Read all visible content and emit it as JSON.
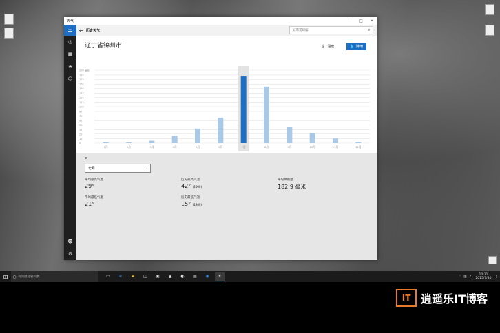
{
  "window": {
    "title": "天气",
    "min": "–",
    "max": "□",
    "close": "✕"
  },
  "header": {
    "page_title": "历史天气",
    "search_placeholder": "城市或邮编"
  },
  "city": "辽宁省锦州市",
  "toggles": {
    "temperature": "温度",
    "rainfall": "降雨"
  },
  "chart_data": {
    "type": "bar",
    "categories": [
      "1月",
      "2月",
      "3月",
      "4月",
      "5月",
      "6月",
      "7月",
      "8月",
      "9月",
      "10月",
      "11月",
      "12月"
    ],
    "values": [
      2.5,
      1.8,
      6.5,
      20,
      40,
      70,
      182.9,
      155,
      45,
      27,
      13,
      3
    ],
    "selected_index": 6,
    "ylim": [
      0,
      200
    ],
    "y_unit": "毫米",
    "yticks": [
      0,
      12,
      25,
      37,
      50,
      62,
      75,
      87,
      100,
      112,
      125,
      137,
      150,
      162,
      175,
      187,
      200
    ],
    "colors": {
      "bar": "#a9c9e6",
      "selected": "#1e6fc4",
      "selected_band": "#e3e3e3"
    }
  },
  "stats": {
    "month_label": "月",
    "month_value": "七月",
    "avg_high_label": "平均最高气温",
    "avg_high_value": "29°",
    "rec_high_label": "历史最高气温",
    "rec_high_value": "42°",
    "rec_high_year": "(2000)",
    "avg_rain_label": "平均降雨量",
    "avg_rain_value": "182.9 毫米",
    "avg_low_label": "平均最低气温",
    "avg_low_value": "21°",
    "rec_low_label": "历史最低气温",
    "rec_low_value": "15°",
    "rec_low_year": "(1989)"
  },
  "taskbar": {
    "search_placeholder": "有问题尽管问我",
    "time": "10:31",
    "date": "2015/7/30"
  },
  "brand": "逍遥乐IT博客"
}
